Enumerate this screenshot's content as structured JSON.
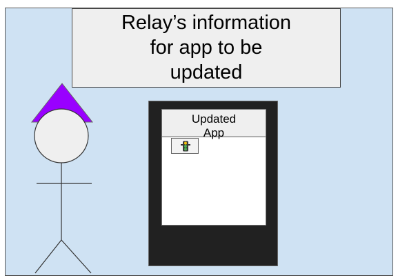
{
  "callout": {
    "text": "Relay’s information\nfor app to be\nupdated"
  },
  "app": {
    "header_text": "Updated\nApp"
  },
  "colors": {
    "background": "#cfe2f3",
    "callout_fill": "#efefef",
    "phone_body": "#212121",
    "hat": "#9900ff",
    "relay_icon": "#4caf50"
  },
  "icons": {
    "relay": "traffic-light-icon"
  }
}
